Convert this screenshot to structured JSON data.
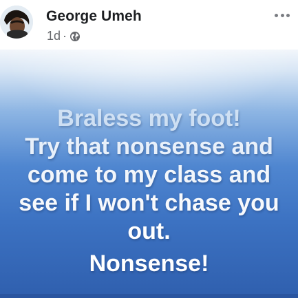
{
  "post": {
    "author": "George Umeh",
    "time": "1d",
    "separator": "·",
    "privacy_icon": "globe-icon",
    "more_icon": "more-horizontal-icon"
  },
  "image": {
    "lines": [
      "Braless my foot!",
      "Try that nonsense and",
      "come to my class and",
      "see if I won't chase you",
      "out.",
      "Nonsense!"
    ]
  },
  "colors": {
    "name": "#1c1e21",
    "meta": "#65676b",
    "background_top": "#f2f6fb",
    "background_bottom": "#2f5fae"
  }
}
